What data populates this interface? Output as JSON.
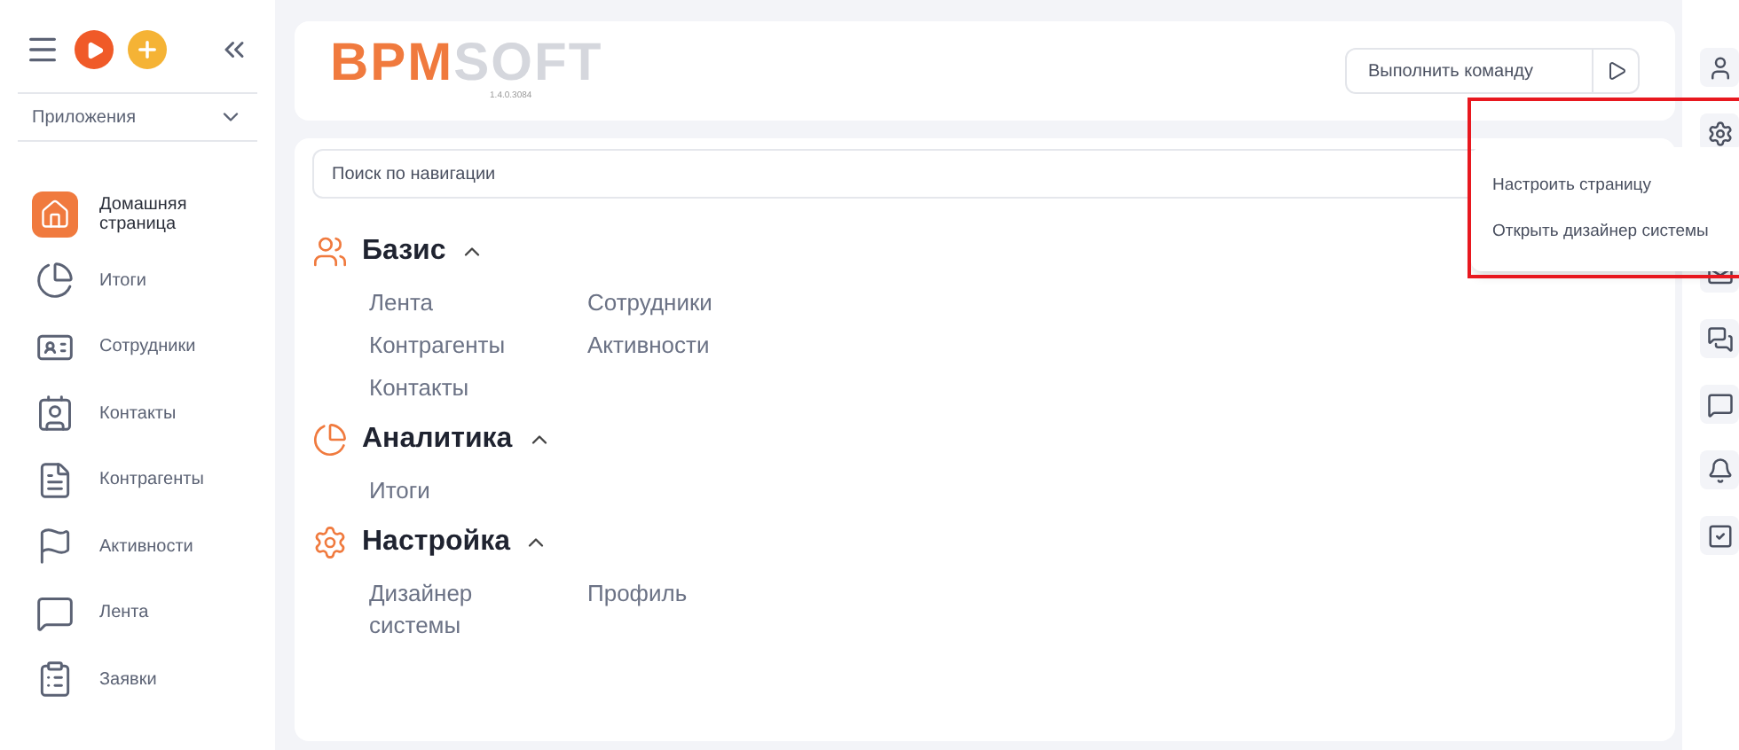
{
  "sidebar": {
    "apps_label": "Приложения",
    "items": [
      {
        "label": "Домашняя страница",
        "kind": "home",
        "selected": true
      },
      {
        "label": "Итоги",
        "kind": "pie",
        "selected": false
      },
      {
        "label": "Сотрудники",
        "kind": "staff",
        "selected": false
      },
      {
        "label": "Контакты",
        "kind": "contact",
        "selected": false
      },
      {
        "label": "Контрагенты",
        "kind": "doc",
        "selected": false
      },
      {
        "label": "Активности",
        "kind": "flag",
        "selected": false
      },
      {
        "label": "Лента",
        "kind": "chat",
        "selected": false
      },
      {
        "label": "Заявки",
        "kind": "clipboard",
        "selected": false
      }
    ]
  },
  "header": {
    "logo_primary": "BPM",
    "logo_secondary": "SOFT",
    "version": "1.4.0.3084",
    "command": {
      "placeholder": "Выполнить команду"
    }
  },
  "search": {
    "placeholder": "Поиск по навигации"
  },
  "sections": [
    {
      "title": "Базис",
      "kind": "people",
      "expanded": true,
      "links": [
        "Лента",
        "Сотрудники",
        "Контрагенты",
        "Активности",
        "Контакты"
      ]
    },
    {
      "title": "Аналитика",
      "kind": "pie",
      "expanded": true,
      "links": [
        "Итоги"
      ]
    },
    {
      "title": "Настройка",
      "kind": "gear",
      "expanded": true,
      "links": [
        "Дизайнер системы",
        "Профиль"
      ]
    }
  ],
  "settings_menu": {
    "open": true,
    "items": [
      "Настроить страницу",
      "Открыть дизайнер системы"
    ]
  }
}
